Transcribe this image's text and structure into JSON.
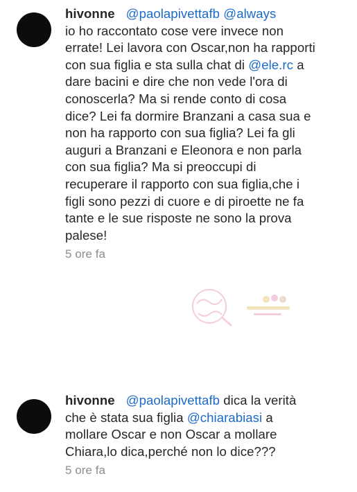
{
  "comments": [
    {
      "username": "hivonne",
      "mention_1": "@paolapivettafb",
      "mention_2": "@always",
      "line_2": "io ho raccontato cose vere invece non",
      "line_3": "errate! Lei lavora con Oscar,non ha rapporti",
      "line_4_pre": "con sua figlia e sta sulla chat di ",
      "line_4_mention": "@ele.rc",
      "line_4_post": " a",
      "line_5": "dare bacini e dire che non vede l'ora di",
      "line_6": "conoscerla? Ma si rende conto di cosa",
      "line_7": "dice? Lei fa dormire Branzani a casa sua e",
      "line_8": "non ha rapporto con sua figlia? Lei fa gli",
      "line_9": "auguri a Branzani e Eleonora e non parla",
      "line_10": "con sua figlia? Ma si preoccupi di",
      "line_11": "recuperare il rapporto con sua figlia,che i",
      "line_12": "figli sono pezzi di cuore e di piroette ne fa",
      "line_13": "tante e le sue risposte ne sono la prova",
      "line_14": "palese!",
      "timestamp": "5 ore fa"
    },
    {
      "username": "hivonne",
      "mention_1": "@paolapivettafb",
      "line_1_post": " dica la verità",
      "line_2_pre": "che è stata sua figlia ",
      "line_2_mention": "@chiarabiasi",
      "line_2_post": " a",
      "line_3": "mollare Oscar e non Oscar a mollare",
      "line_4": "Chiara,lo dica,perché non lo dice???",
      "timestamp": "5 ore fa"
    }
  ],
  "colors": {
    "mention": "#1b6ac9",
    "text": "#262626",
    "timestamp": "#8e8e8e",
    "avatar": "#0c0c0c",
    "watermark_pink": "#e88fb8",
    "watermark_gold": "#e6c46a"
  },
  "watermark": {
    "icon": "watermark-logo-icon"
  }
}
